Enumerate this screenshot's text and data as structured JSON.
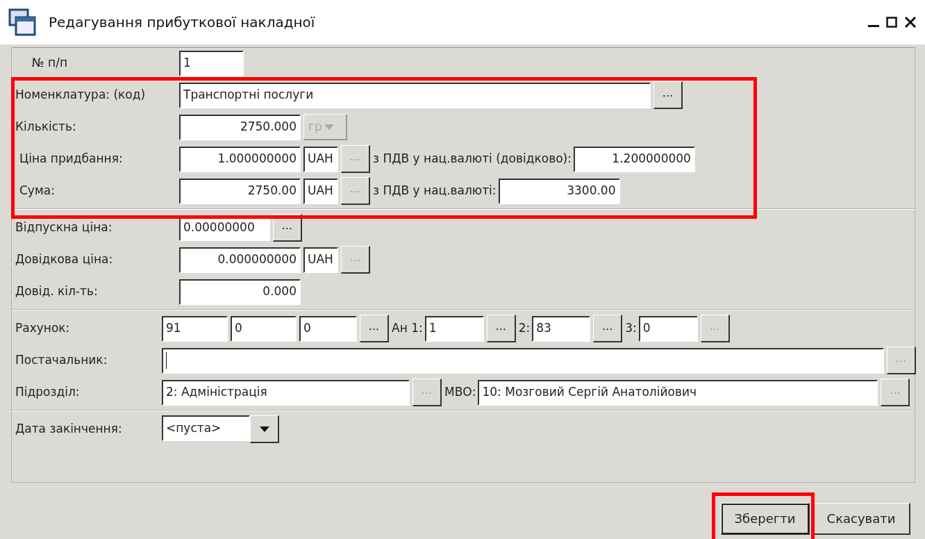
{
  "window": {
    "title": "Редагування прибуткової накладної"
  },
  "sections": [
    {
      "rows": [
        {
          "label": "№ п/п",
          "items": [
            {
              "kind": "field",
              "value": "1"
            }
          ]
        },
        {
          "label": "Номенклатура: (код)",
          "items": [
            {
              "kind": "field",
              "value": "Транспортні послуги"
            },
            {
              "kind": "button",
              "label": "...",
              "disabled": false
            }
          ]
        },
        {
          "label": "Кількість:",
          "items": [
            {
              "kind": "number",
              "value": "2750.000"
            },
            {
              "kind": "combo",
              "value": "гр",
              "disabled": true
            }
          ]
        },
        {
          "label": "Ціна придбання:",
          "items": [
            {
              "kind": "number",
              "value": "1.000000000"
            },
            {
              "kind": "field",
              "value": "UAH"
            },
            {
              "kind": "button",
              "label": "...",
              "disabled": true
            },
            {
              "kind": "caption",
              "text": "з ПДВ у нац.валюті (довідково):"
            },
            {
              "kind": "number",
              "value": "1.200000000"
            }
          ]
        },
        {
          "label": "Сума:",
          "items": [
            {
              "kind": "number",
              "value": "2750.00"
            },
            {
              "kind": "field",
              "value": "UAH"
            },
            {
              "kind": "button",
              "label": "...",
              "disabled": true
            },
            {
              "kind": "caption",
              "text": "з ПДВ у нац.валюті:"
            },
            {
              "kind": "number",
              "value": "3300.00"
            }
          ]
        }
      ]
    },
    {
      "rows": [
        {
          "label": "Відпускна ціна:",
          "items": [
            {
              "kind": "field",
              "value": "0.00000000"
            },
            {
              "kind": "button",
              "label": "...",
              "disabled": false
            }
          ]
        },
        {
          "label": "Довідкова ціна:",
          "items": [
            {
              "kind": "number",
              "value": "0.000000000"
            },
            {
              "kind": "field",
              "value": "UAH"
            },
            {
              "kind": "button",
              "label": "...",
              "disabled": true
            }
          ]
        },
        {
          "label": "Довід. кіл-ть:",
          "items": [
            {
              "kind": "number",
              "value": "0.000"
            }
          ]
        }
      ]
    },
    {
      "rows": [
        {
          "label": "Рахунок:",
          "items": [
            {
              "kind": "field",
              "value": "91"
            },
            {
              "kind": "field",
              "value": "0"
            },
            {
              "kind": "field",
              "value": "0"
            },
            {
              "kind": "button",
              "label": "...",
              "disabled": false
            },
            {
              "kind": "caption",
              "text": "Ан 1:"
            },
            {
              "kind": "field",
              "value": "1"
            },
            {
              "kind": "button",
              "label": "...",
              "disabled": false
            },
            {
              "kind": "caption",
              "text": "2:"
            },
            {
              "kind": "field",
              "value": "83"
            },
            {
              "kind": "button",
              "label": "...",
              "disabled": false
            },
            {
              "kind": "caption",
              "text": "3:"
            },
            {
              "kind": "field",
              "value": "0"
            },
            {
              "kind": "button",
              "label": "...",
              "disabled": true
            }
          ]
        },
        {
          "label": "Постачальник:",
          "items": [
            {
              "kind": "field",
              "value": "",
              "focused": true
            },
            {
              "kind": "button",
              "label": "...",
              "disabled": true
            }
          ]
        },
        {
          "label": "Підрозділ:",
          "items": [
            {
              "kind": "field",
              "value": "2: Адміністрація"
            },
            {
              "kind": "button",
              "label": "...",
              "disabled": true
            },
            {
              "kind": "caption",
              "text": "МВО:"
            },
            {
              "kind": "field",
              "value": "10: Мозговий Сергій Анатолійович"
            },
            {
              "kind": "button",
              "label": "...",
              "disabled": true
            }
          ]
        }
      ]
    },
    {
      "rows": [
        {
          "label": "Дата закінчення:",
          "items": [
            {
              "kind": "date",
              "value": "<пуста>"
            }
          ]
        }
      ]
    }
  ],
  "buttons": [
    {
      "label": "Зберегти",
      "default": true
    },
    {
      "label": "Скасувати",
      "default": false
    }
  ]
}
